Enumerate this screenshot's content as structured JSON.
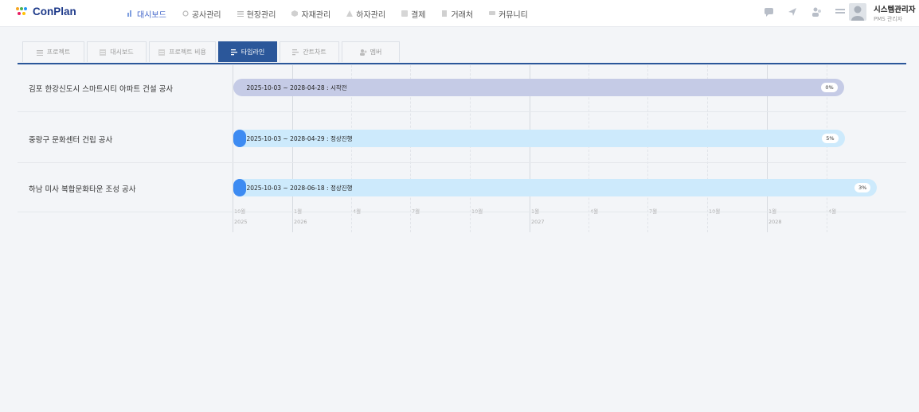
{
  "app": {
    "logo_text": "ConPlan"
  },
  "nav": [
    {
      "label": "대시보드",
      "icon": "bar-chart-icon",
      "active": true
    },
    {
      "label": "공사관리",
      "icon": "circle-icon"
    },
    {
      "label": "현장관리",
      "icon": "list-icon"
    },
    {
      "label": "자재관리",
      "icon": "box-icon"
    },
    {
      "label": "하자관리",
      "icon": "warning-icon"
    },
    {
      "label": "결제",
      "icon": "check-icon"
    },
    {
      "label": "거래처",
      "icon": "building-icon"
    },
    {
      "label": "커뮤니티",
      "icon": "chat-icon"
    }
  ],
  "user": {
    "name": "시스템관리자",
    "role": "PMS 관리자"
  },
  "tabs": [
    {
      "label": "프로젝트",
      "icon": "list-icon"
    },
    {
      "label": "대시보드",
      "icon": "grid-icon"
    },
    {
      "label": "프로젝트 비용",
      "icon": "grid-icon"
    },
    {
      "label": "타임라인",
      "icon": "timeline-icon",
      "active": true
    },
    {
      "label": "간트차트",
      "icon": "timeline-icon"
    },
    {
      "label": "멤버",
      "icon": "users-icon"
    }
  ],
  "colors": {
    "accent": "#2b579a",
    "bar_done": "#c5cbe6",
    "bar_active": "#cdeafc",
    "fill": "#3d8bf2"
  },
  "timeline": {
    "start": "2025-08-01",
    "end": "2028-07-01",
    "rows": [
      {
        "name": "김포 한강신도시 스마트시티 아파트 건설 공사",
        "range": "2025-10-03 ~ 2028-04-28 : 시작전",
        "start": "2025-10-03",
        "end": "2028-04-28",
        "progress": 0,
        "pct": "0%",
        "status": "pending"
      },
      {
        "name": "중랑구 문화센터 건립 공사",
        "range": "2025-10-03 ~ 2028-04-29 : 정상진행",
        "start": "2025-10-03",
        "end": "2028-04-29",
        "progress": 5,
        "pct": "5%",
        "status": "active"
      },
      {
        "name": "하남 미사 복합문화타운 조성 공사",
        "range": "2025-10-03 ~ 2028-06-18 : 정상진행",
        "start": "2025-10-03",
        "end": "2028-06-18",
        "progress": 3,
        "pct": "3%",
        "status": "active"
      }
    ],
    "axis": [
      {
        "label": "10월",
        "year": "2025",
        "date": "2025-10-01"
      },
      {
        "label": "1월",
        "year": "2026",
        "date": "2026-01-01"
      },
      {
        "label": "4월",
        "date": "2026-04-01"
      },
      {
        "label": "7월",
        "date": "2026-07-01"
      },
      {
        "label": "10월",
        "date": "2026-10-01"
      },
      {
        "label": "1월",
        "year": "2027",
        "date": "2027-01-01"
      },
      {
        "label": "4월",
        "date": "2027-04-01"
      },
      {
        "label": "7월",
        "date": "2027-07-01"
      },
      {
        "label": "10월",
        "date": "2027-10-01"
      },
      {
        "label": "1월",
        "year": "2028",
        "date": "2028-01-01"
      },
      {
        "label": "4월",
        "date": "2028-04-01"
      }
    ]
  }
}
